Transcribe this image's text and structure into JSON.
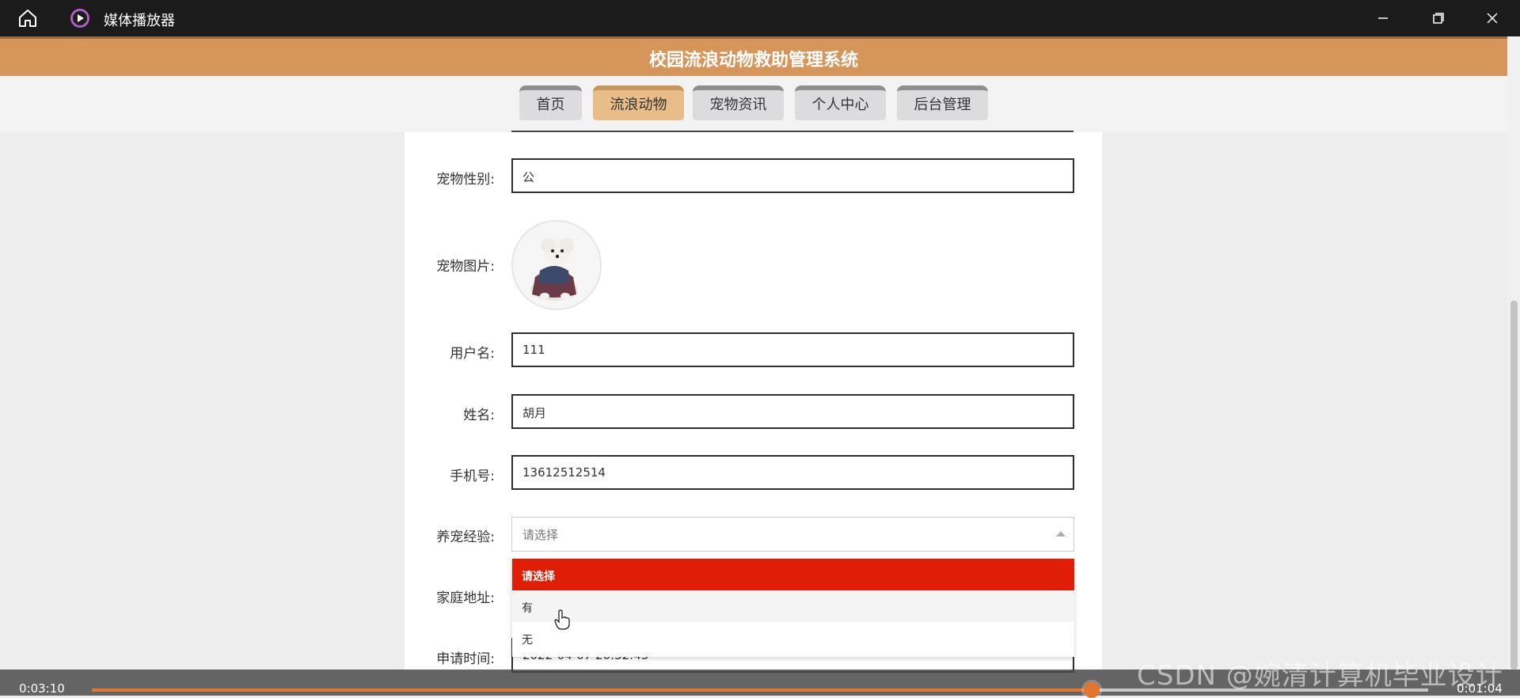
{
  "window": {
    "app_title": "媒体播放器",
    "icons": {
      "home": "home-icon",
      "app": "play-icon",
      "minimize": "minimize-icon",
      "restore": "restore-icon",
      "close": "close-icon"
    }
  },
  "site": {
    "title": "校园流浪动物救助管理系统"
  },
  "nav": {
    "tabs": [
      {
        "label": "首页",
        "active": false
      },
      {
        "label": "流浪动物",
        "active": true
      },
      {
        "label": "宠物资讯",
        "active": false
      },
      {
        "label": "个人中心",
        "active": false
      },
      {
        "label": "后台管理",
        "active": false
      }
    ]
  },
  "form": {
    "pet_gender": {
      "label": "宠物性别:",
      "value": "公"
    },
    "pet_image": {
      "label": "宠物图片:"
    },
    "username": {
      "label": "用户名:",
      "value": "111"
    },
    "name": {
      "label": "姓名:",
      "value": "胡月"
    },
    "phone": {
      "label": "手机号:",
      "value": "13612512514"
    },
    "experience": {
      "label": "养宠经验:",
      "placeholder": "请选择",
      "options": [
        "请选择",
        "有",
        "无"
      ],
      "selected_index": 0,
      "hover_index": 1
    },
    "address": {
      "label": "家庭地址:"
    },
    "apply_time": {
      "label": "申请时间:",
      "value": "2022-04-07 20:32:43"
    }
  },
  "player": {
    "elapsed": "0:03:10",
    "remaining": "0:01:04",
    "progress": 0.748
  },
  "watermark": "CSDN @婉清计算机毕业设计",
  "colors": {
    "accent": "#d6965a",
    "active_tab": "#e8bd87",
    "option_selected": "#e01e08",
    "progress": "#e4752d"
  }
}
